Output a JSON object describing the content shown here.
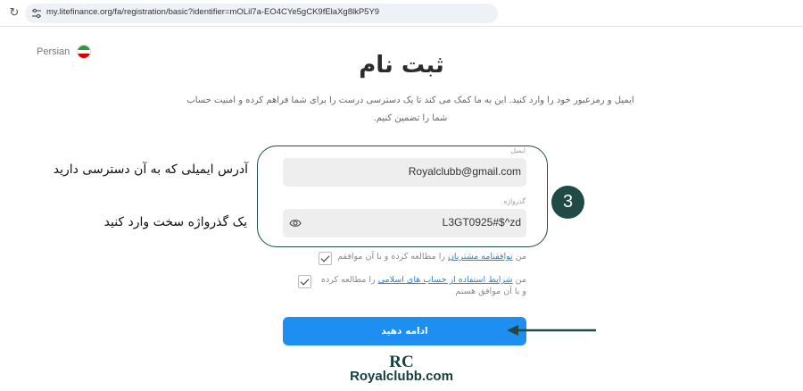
{
  "browser": {
    "url": "my.litefinance.org/fa/registration/basic?identifier=mOLil7a-EO4CYe5gCK9fElaXg8lkP5Y9"
  },
  "language": {
    "label": "Persian",
    "flag_colors": [
      "#239f40",
      "#ffffff",
      "#da0000"
    ]
  },
  "page": {
    "title": "ثبت نام",
    "description": "ایمیل و رمزعبور خود را وارد کنید. این به ما کمک می کند تا یک دسترسی درست را برای شما فراهم کرده و امنیت حساب شما را تضمین کنیم."
  },
  "form": {
    "email_label": "ایمیل",
    "email_value": "Royalclubb@gmail.com",
    "password_label": "گذرواژه",
    "password_value": "L3GT0925#$^zd",
    "agreement_1": {
      "prefix": "من ",
      "link": "توافقنامه مشتریان",
      "suffix": " را مطالعه کرده و با آن موافقم"
    },
    "agreement_2": {
      "prefix": "من ",
      "link": "شرایط استفاده از حساب های اسلامی",
      "suffix": " را مطالعه کرده و با آن موافق هستم"
    },
    "submit_label": "ادامه دهید"
  },
  "annotations": {
    "step_number": "3",
    "email_note": "آدرس ایمیلی که به آن دسترسی دارید",
    "password_note": "یک گذرواژه سخت وارد کنید"
  },
  "watermark": {
    "mark": "RC",
    "text": "Royalclubb.com"
  },
  "colors": {
    "accent": "#1f8ef1",
    "annotation": "#1f4a45",
    "link": "#2a86d6"
  }
}
